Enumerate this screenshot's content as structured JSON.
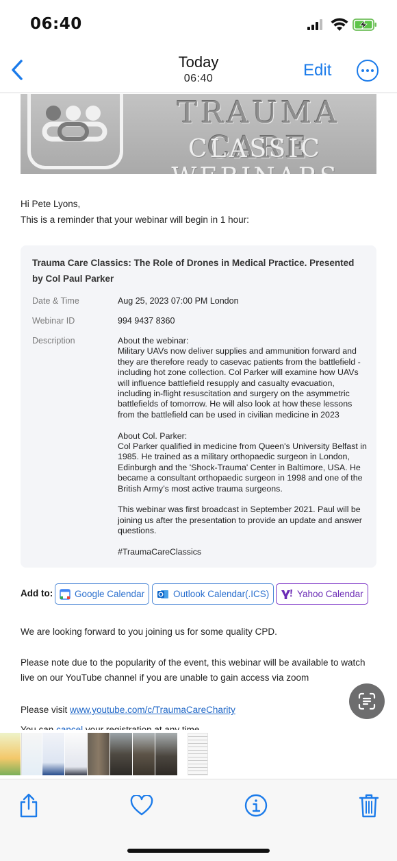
{
  "status_bar": {
    "time": "06:40"
  },
  "nav": {
    "title": "Today",
    "subtitle": "06:40",
    "edit_label": "Edit"
  },
  "banner": {
    "line1": "TRAUMA CARE",
    "line2": "CLASSIC WEBINARS"
  },
  "email": {
    "greeting": "Hi Pete Lyons,",
    "intro": "This is a reminder that your webinar will begin in 1 hour:",
    "card": {
      "title": "Trauma Care Classics: The Role of Drones in Medical Practice. Presented by Col Paul Parker",
      "rows": [
        {
          "label": "Date & Time",
          "value": "Aug 25, 2023 07:00 PM London"
        },
        {
          "label": "Webinar ID",
          "value": "994 9437 8360"
        },
        {
          "label": "Description"
        }
      ],
      "description": [
        "About the webinar:\nMilitary UAVs now deliver supplies and ammunition forward and they are therefore ready to casevac patients from the battlefield - including hot zone collection. Col Parker will examine how UAVs will influence battlefield resupply and casualty evacuation, including in-flight resuscitation and surgery on the asymmetric battlefields of tomorrow. He will also look at how these lessons from the battlefield can be used in civilian medicine in 2023",
        "About Col. Parker:\nCol Parker qualified in medicine from Queen's University Belfast in 1985. He trained as a military orthopaedic surgeon in London, Edinburgh and the 'Shock-Trauma' Center in Baltimore, USA. He became a consultant orthopaedic surgeon in 1998 and one of the British Army’s most active trauma surgeons.",
        "This webinar was first broadcast in September 2021. Paul will be joining us after the presentation to provide an update and answer questions.",
        "#TraumaCareClassics"
      ]
    },
    "add_to": {
      "label": "Add to:",
      "google": "Google Calendar",
      "outlook": "Outlook Calendar(.ICS)",
      "yahoo": "Yahoo Calendar"
    },
    "looking_forward": "We are looking forward to you joining us for some quality CPD.",
    "popularity_note": "Please note due to the popularity of the event, this webinar will be available to watch live on our YouTube channel if you are unable to gain access via zoom",
    "visit_prefix": "Please visit ",
    "youtube_link": "www.youtube.com/c/TraumaCareCharity",
    "cancel_prefix": "You can ",
    "cancel_link": "cancel",
    "cancel_suffix": " your registration at any time."
  },
  "icons": {
    "back": "chevron-left-icon",
    "more": "ellipsis-circle-icon",
    "scan": "live-text-icon",
    "share": "share-icon",
    "favorite": "heart-icon",
    "info": "info-icon",
    "delete": "trash-icon"
  },
  "colors": {
    "accent": "#1b7bea",
    "card_bg": "#f4f5f8",
    "link": "#1e66c7",
    "yahoo": "#7b33c6"
  }
}
